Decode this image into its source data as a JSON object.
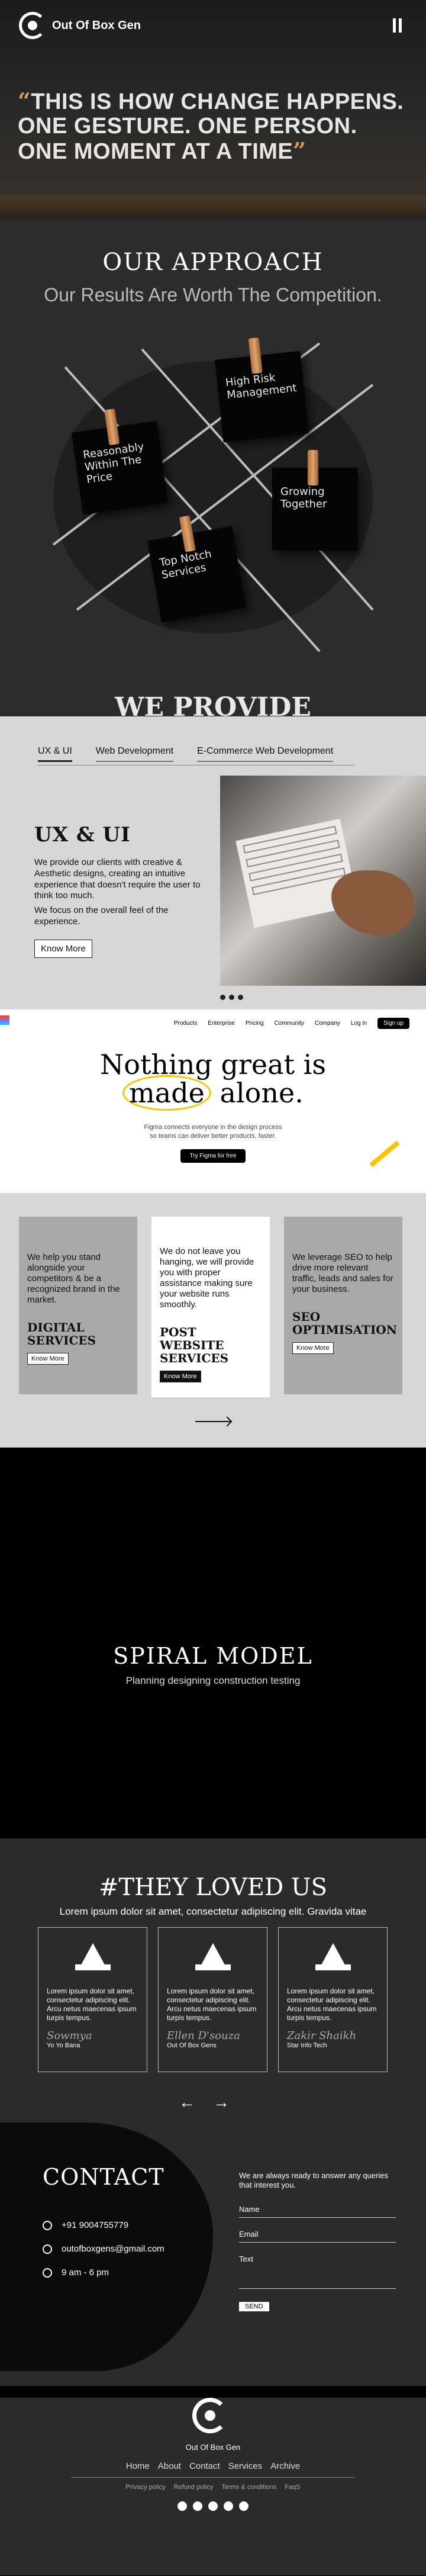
{
  "header": {
    "brand": "Out Of Box Gen"
  },
  "hero": {
    "open_quote": "“",
    "quote": "THIS IS HOW CHANGE HAPPENS. ONE GESTURE. ONE PERSON. ONE MOMENT AT A TIME",
    "close_quote": "”"
  },
  "approach": {
    "title": "OUR APPROACH",
    "subtitle": "Our Results Are Worth The Competition.",
    "notes": [
      "Reasonably Within The Price",
      "High Risk Management",
      "Growing Together",
      "Top Notch Services"
    ]
  },
  "provide": {
    "title": "WE PROVIDE",
    "tabs": [
      "UX & UI",
      "Web Development",
      "E-Commerce Web Development"
    ],
    "heading": "UX & UI",
    "para1": "We provide our clients with creative & Aesthetic designs, creating an intuitive experience that doesn't require the user to think too much.",
    "para2": "We focus on the overall feel of the experience.",
    "button": "Know More"
  },
  "figma": {
    "nav": [
      "Products",
      "Enterprise",
      "Pricing",
      "Community",
      "Company",
      "Log in"
    ],
    "signup": "Sign up",
    "headline_pre": "Nothing great is",
    "headline_circled": "made",
    "headline_post": "alone.",
    "sub1": "Figma connects everyone in the design process",
    "sub2": "so teams can deliver better products, faster.",
    "cta": "Try Figma for free"
  },
  "services": [
    {
      "text": "We help you stand alongside your competitors & be a recognized brand in the market.",
      "title": "DIGITAL SERVICES",
      "button": "Know More"
    },
    {
      "text": "We do not leave you hanging, we will provide you with proper assistance making sure your website runs smoothly.",
      "title": "POST WEBSITE SERVICES",
      "button": "Know More"
    },
    {
      "text": "We leverage SEO to help drive more relevant traffic, leads and sales for your business.",
      "title": "SEO OPTIMISATION",
      "button": "Know More"
    }
  ],
  "spiral": {
    "title": "SPIRAL MODEL",
    "subtitle": "Planning designing construction testing"
  },
  "testimonials": {
    "title": "#THEY LOVED US",
    "subtitle": "Lorem ipsum dolor sit amet, consectetur adipiscing elit. Gravida vitae",
    "items": [
      {
        "text": "Lorem ipsum dolor sit amet, consectetur adipiscing elit. Arcu netus maecenas ipsum turpis tempus.",
        "name": "Sowmya",
        "company": "Yo Yo Bana"
      },
      {
        "text": "Lorem ipsum dolor sit amet, consectetur adipiscing elit. Arcu netus maecenas ipsum turpis tempus.",
        "name": "Ellen D'souza",
        "company": "Out Of Box Gens"
      },
      {
        "text": "Lorem ipsum dolor sit amet, consectetur adipiscing elit. Arcu netus maecenas ipsum turpis tempus.",
        "name": "Zakir Shaikh",
        "company": "Star Info Tech"
      }
    ],
    "prev": "←",
    "next": "→"
  },
  "contact": {
    "title": "CONTACT",
    "phone": "+91 9004755779",
    "email": "outofboxgens@gmail.com",
    "hours": "9 am - 6 pm",
    "intro": "We are always ready to answer any queries that interest you.",
    "fields": [
      "Name",
      "Email",
      "Text"
    ],
    "send": "SEND"
  },
  "footer": {
    "brand": "Out Of Box Gen",
    "links": [
      "Home",
      "About",
      "Contact",
      "Services",
      "Archive"
    ],
    "legal": [
      "Privacy policy",
      "Refund policy",
      "Terms & conditions",
      "FaqS"
    ]
  }
}
